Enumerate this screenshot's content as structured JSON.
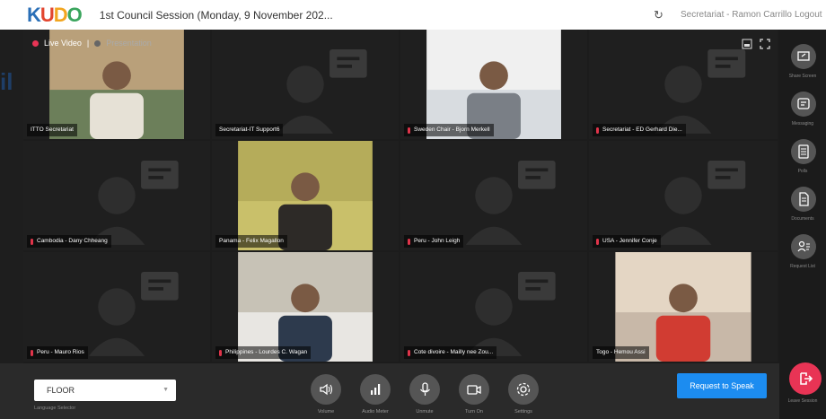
{
  "app": {
    "logo": [
      "K",
      "U",
      "D",
      "O"
    ],
    "session_title": "1st Council Session (Monday, 9 November 202...",
    "reload_icon": "refresh-icon",
    "user": "Secretariat - Ramon Carrillo",
    "logout": "Logout"
  },
  "side_tab": {
    "text": "il"
  },
  "badges": {
    "live": "Live Video",
    "separator": "|",
    "presentation": "Presentation"
  },
  "tiles": [
    {
      "name": "ITTO Secretariat",
      "has_video": true,
      "mic": false
    },
    {
      "name": "Secretariat-IT Support6",
      "has_video": false,
      "mic": false
    },
    {
      "name": "Sweden Chair - Bjorn Merkell",
      "has_video": true,
      "mic": true
    },
    {
      "name": "Secretariat - ED Gerhard Die...",
      "has_video": false,
      "mic": true
    },
    {
      "name": "Cambodia - Dany Chheang",
      "has_video": false,
      "mic": true
    },
    {
      "name": "Panama - Felix Magallon",
      "has_video": true,
      "mic": false
    },
    {
      "name": "Peru - John Leigh",
      "has_video": false,
      "mic": true
    },
    {
      "name": "USA - Jennifer Conje",
      "has_video": false,
      "mic": true
    },
    {
      "name": "Peru - Mauro Rios",
      "has_video": false,
      "mic": true
    },
    {
      "name": "Philippines - Lourdes C. Wagan",
      "has_video": true,
      "mic": true
    },
    {
      "name": "Cote divoire - Mailly nee Zou...",
      "has_video": false,
      "mic": true
    },
    {
      "name": "Togo - Hemou Assi",
      "has_video": true,
      "mic": false
    }
  ],
  "rail": [
    {
      "label": "Share Screen",
      "icon": "share-screen-icon"
    },
    {
      "label": "Messaging",
      "icon": "message-icon"
    },
    {
      "label": "Polls",
      "icon": "polls-icon"
    },
    {
      "label": "Documents",
      "icon": "documents-icon"
    },
    {
      "label": "Request List",
      "icon": "request-list-icon"
    }
  ],
  "leave": {
    "label": "Leave Session",
    "icon": "leave-icon",
    "color": "#e83455"
  },
  "controls": [
    {
      "label": "Volume",
      "icon": "volume-icon"
    },
    {
      "label": "Audio Meter",
      "icon": "audio-meter-icon"
    },
    {
      "label": "Unmute",
      "icon": "microphone-icon"
    },
    {
      "label": "Turn On",
      "icon": "camera-icon"
    },
    {
      "label": "Settings",
      "icon": "gear-icon"
    }
  ],
  "language": {
    "selected": "FLOOR",
    "label": "Language Selector"
  },
  "request_speak": {
    "label": "Request to Speak",
    "color": "#1c8cf0"
  }
}
